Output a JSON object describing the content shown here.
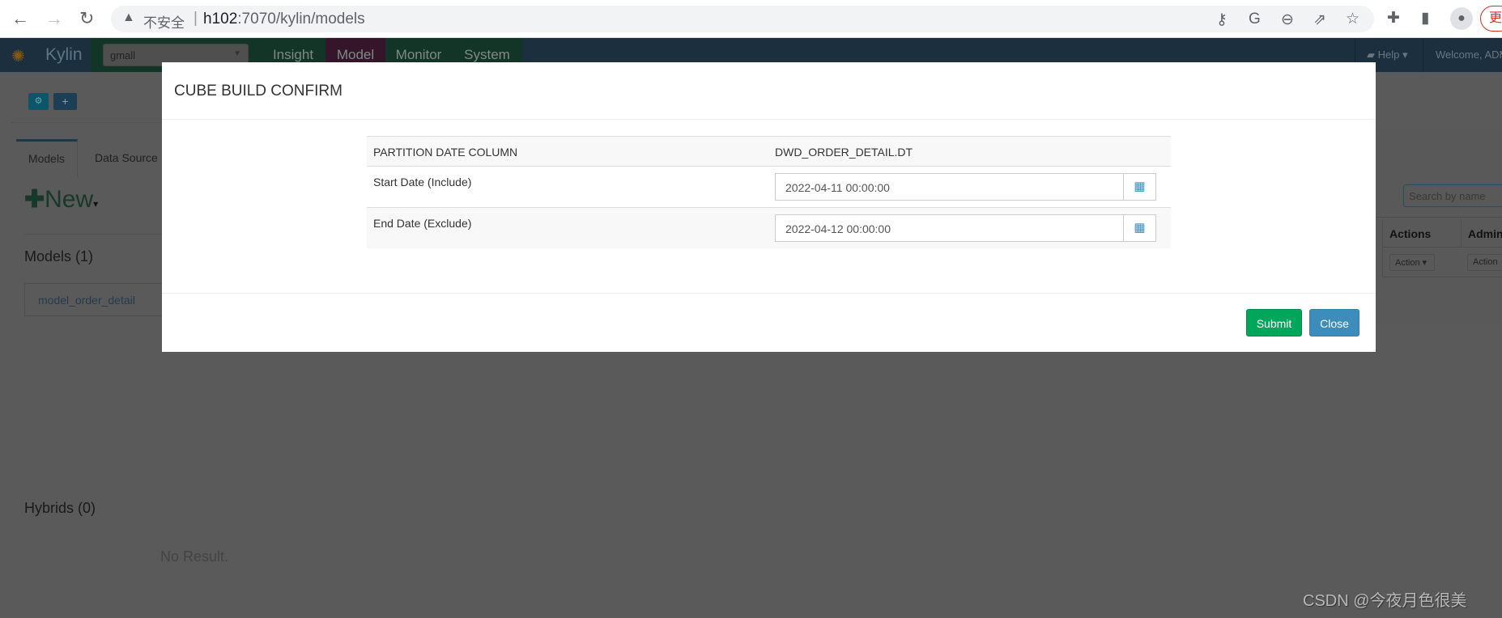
{
  "browser": {
    "insecure_label": "不安全",
    "url_host": "h102",
    "url_rest": ":7070/kylin/models",
    "update_label": "更"
  },
  "navbar": {
    "brand": "Kylin",
    "project": "gmall",
    "tabs": [
      "Insight",
      "Model",
      "Monitor",
      "System"
    ],
    "help": "Help",
    "welcome": "Welcome, ADM"
  },
  "page": {
    "tabs": [
      "Models",
      "Data Source"
    ],
    "new_label": "New",
    "models_heading": "Models (1)",
    "model_item": "model_order_detail",
    "hybrids_heading": "Hybrids (0)",
    "no_result": "No Result.",
    "search_placeholder": "Search by name",
    "table_headers": [
      "Actions",
      "Admin"
    ],
    "action_label": "Action"
  },
  "modal": {
    "title": "CUBE BUILD CONFIRM",
    "partition_label": "PARTITION DATE COLUMN",
    "partition_value": "DWD_ORDER_DETAIL.DT",
    "start_label": "Start Date (Include)",
    "start_value": "2022-04-11 00:00:00",
    "end_label": "End Date (Exclude)",
    "end_value": "2022-04-12 00:00:00",
    "submit": "Submit",
    "close": "Close"
  },
  "watermark": "CSDN @今夜月色很美",
  "colors": {
    "submit": "#00a65a",
    "close": "#3c8dbc",
    "navbar": "#1b2f3e"
  }
}
